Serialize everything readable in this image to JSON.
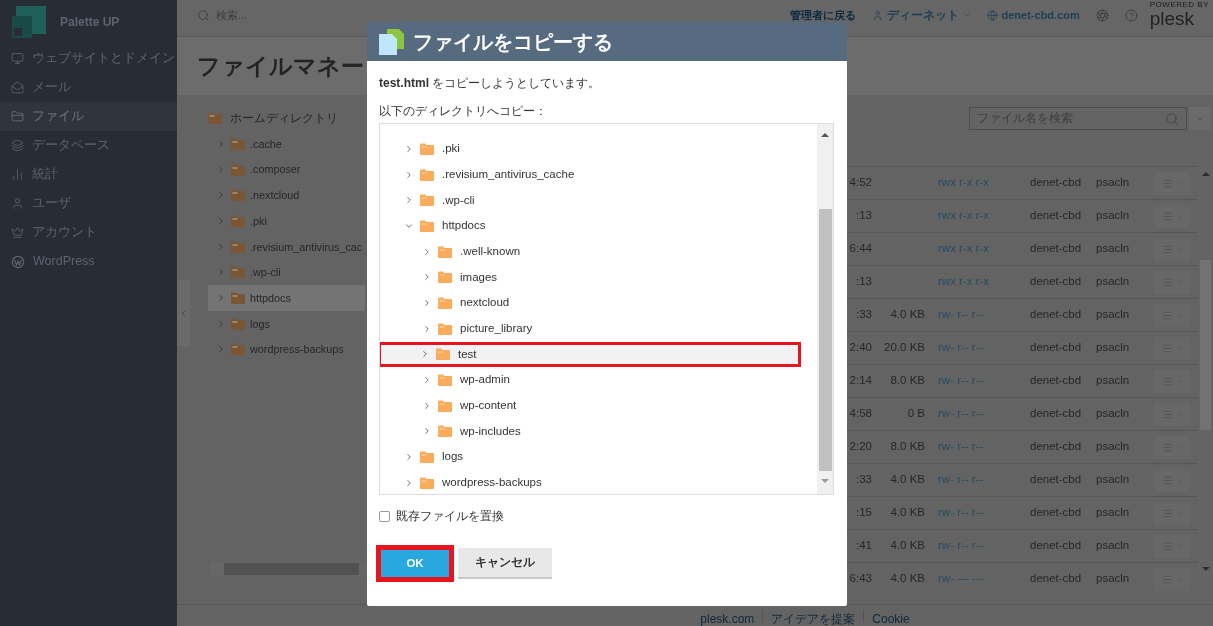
{
  "sidebar": {
    "brand": "Palette UP",
    "items": [
      {
        "label": "ウェブサイトとドメイン",
        "selected": false
      },
      {
        "label": "メール",
        "selected": false
      },
      {
        "label": "ファイル",
        "selected": true
      },
      {
        "label": "データベース",
        "selected": false
      },
      {
        "label": "統計",
        "selected": false
      },
      {
        "label": "ユーザ",
        "selected": false
      },
      {
        "label": "アカウント",
        "selected": false
      },
      {
        "label": "WordPress",
        "selected": false
      }
    ]
  },
  "topbar": {
    "search_placeholder": "検索...",
    "back_link": "管理者に戻る",
    "user": "ディーネット",
    "domain": "denet-cbd.com",
    "powered_by": "POWERED BY",
    "logo": "plesk"
  },
  "page": {
    "title": "ファイルマネー",
    "tree": {
      "root": "ホームディレクトリ",
      "items": [
        {
          "name": ".cache",
          "selected": false
        },
        {
          "name": ".composer",
          "selected": false
        },
        {
          "name": ".nextcloud",
          "selected": false
        },
        {
          "name": ".pki",
          "selected": false
        },
        {
          "name": ".revisium_antivirus_cac",
          "selected": false
        },
        {
          "name": ".wp-cli",
          "selected": false
        },
        {
          "name": "httpdocs",
          "selected": true
        },
        {
          "name": "logs",
          "selected": false
        },
        {
          "name": "wordpress-backups",
          "selected": false
        }
      ]
    },
    "file_search": {
      "placeholder": "ファイル名を検索"
    },
    "table": {
      "rows": [
        {
          "column_1": "4:52",
          "column_3": "rwx r-x r-x",
          "column_4": "denet-cbd",
          "column_5": "psacln"
        },
        {
          "column_1": ":13",
          "column_3": "rwx r-x r-x",
          "column_4": "denet-cbd",
          "column_5": "psacln"
        },
        {
          "column_1": "6:44",
          "column_3": "rwx r-x r-x",
          "column_4": "denet-cbd",
          "column_5": "psacln"
        },
        {
          "column_1": ":13",
          "column_3": "rwx r-x r-x",
          "column_4": "denet-cbd",
          "column_5": "psacln"
        },
        {
          "column_1": ":33",
          "column_2": "4.0 KB",
          "column_3": "rw- r-- r--",
          "column_4": "denet-cbd",
          "column_5": "psacln"
        },
        {
          "column_1": "2:40",
          "column_2": "20.0 KB",
          "column_3": "rw- r-- r--",
          "column_4": "denet-cbd",
          "column_5": "psacln"
        },
        {
          "column_1": "2:14",
          "column_2": "8.0 KB",
          "column_3": "rw- r-- r--",
          "column_4": "denet-cbd",
          "column_5": "psacln"
        },
        {
          "column_1": "4:58",
          "column_2": "0 B",
          "column_3": "rw- r-- r--",
          "column_4": "denet-cbd",
          "column_5": "psacln"
        },
        {
          "column_1": "2:20",
          "column_2": "8.0 KB",
          "column_3": "rw- r-- r--",
          "column_4": "denet-cbd",
          "column_5": "psacln"
        },
        {
          "column_1": ":33",
          "column_2": "4.0 KB",
          "column_3": "rw- r-- r--",
          "column_4": "denet-cbd",
          "column_5": "psacln"
        },
        {
          "column_1": ":15",
          "column_2": "4.0 KB",
          "column_3": "rw- r-- r--",
          "column_4": "denet-cbd",
          "column_5": "psacln"
        },
        {
          "column_1": ":41",
          "column_2": "4.0 KB",
          "column_3": "rw- r-- r--",
          "column_4": "denet-cbd",
          "column_5": "psacln"
        },
        {
          "column_1": "6:43",
          "column_2": "4.0 KB",
          "column_3": "rw- --- ---",
          "column_4": "denet-cbd",
          "column_5": "psacln"
        }
      ]
    }
  },
  "footer": [
    "plesk.com",
    "アイデアを提案",
    "Cookie"
  ],
  "dialog": {
    "title": "ファイルをコピーする",
    "message": "**test.html** をコピーしようとしています。",
    "tree_label": "以下のディレクトリへコピー：",
    "tree": [
      {
        "name": ".pki",
        "expanded": false,
        "selected": false,
        "annotated": false
      },
      {
        "name": ".revisium_antivirus_cache",
        "expanded": false,
        "selected": false,
        "annotated": false
      },
      {
        "name": ".wp-cli",
        "expanded": false,
        "selected": false,
        "annotated": false
      },
      {
        "name": "httpdocs",
        "expanded": true,
        "selected": false,
        "annotated": false,
        "children": [
          {
            "name": ".well-known",
            "expanded": false,
            "selected": false,
            "annotated": false
          },
          {
            "name": "images",
            "expanded": false,
            "selected": false,
            "annotated": false
          },
          {
            "name": "nextcloud",
            "expanded": false,
            "selected": false,
            "annotated": false
          },
          {
            "name": "picture_library",
            "expanded": false,
            "selected": false,
            "annotated": false
          },
          {
            "name": "test",
            "expanded": false,
            "selected": true,
            "annotated": true
          },
          {
            "name": "wp-admin",
            "expanded": false,
            "selected": false,
            "annotated": false
          },
          {
            "name": "wp-content",
            "expanded": false,
            "selected": false,
            "annotated": false
          },
          {
            "name": "wp-includes",
            "expanded": false,
            "selected": false,
            "annotated": false
          }
        ]
      },
      {
        "name": "logs",
        "expanded": false,
        "selected": false,
        "annotated": false
      },
      {
        "name": "wordpress-backups",
        "expanded": false,
        "selected": false,
        "annotated": false
      }
    ],
    "replace_checkbox": {
      "label": "既存ファイルを置換",
      "checked": false
    },
    "buttons": [
      {
        "label": "OK",
        "kind": "primary",
        "annotated": true
      },
      {
        "label": "キャンセル",
        "kind": "secondary",
        "annotated": false
      }
    ]
  }
}
